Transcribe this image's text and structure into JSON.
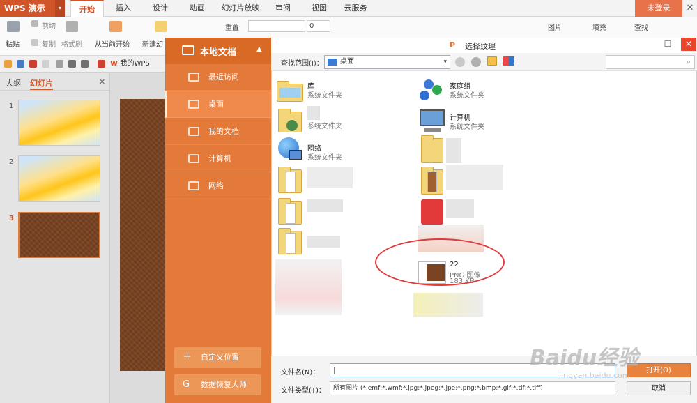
{
  "app": {
    "name": "WPS 演示",
    "login": "未登录",
    "close": "✕",
    "dropdown_arrow": "▾"
  },
  "tabs": [
    "开始",
    "插入",
    "设计",
    "动画",
    "幻灯片放映",
    "审阅",
    "视图",
    "云服务"
  ],
  "active_tab": "开始",
  "ribbon": {
    "paste": "粘贴",
    "cut": "剪切",
    "copy": "复制",
    "format_painter": "格式刷",
    "from_current": "从当前开始",
    "new_slide": "新建幻",
    "reset": "重置",
    "font_size": "0",
    "picture": "图片",
    "fill": "填充",
    "find": "查找"
  },
  "quickbar": {
    "doc_tab": "我的WPS"
  },
  "leftpanel": {
    "tab_outline": "大纲",
    "tab_slides": "幻灯片",
    "close": "✕",
    "slides": [
      {
        "num": "1",
        "kind": "gradient"
      },
      {
        "num": "2",
        "kind": "gradient"
      },
      {
        "num": "3",
        "kind": "leather",
        "selected": true
      }
    ]
  },
  "sidebar": {
    "title": "本地文档",
    "items": [
      {
        "label": "最近访问",
        "icon": "recent-folder-icon"
      },
      {
        "label": "桌面",
        "icon": "desktop-icon",
        "active": true
      },
      {
        "label": "我的文档",
        "icon": "documents-folder-icon"
      },
      {
        "label": "计算机",
        "icon": "computer-icon"
      },
      {
        "label": "网络",
        "icon": "network-icon"
      }
    ],
    "custom_location": "自定义位置",
    "data_recovery": "数据恢复大师"
  },
  "dialog": {
    "title": "选择纹理",
    "look_in_label": "查找范围(I)：",
    "look_in_value": "桌面",
    "files": [
      {
        "name": "库",
        "type": "系统文件夹",
        "icon": "library-icon"
      },
      {
        "name": "家庭组",
        "type": "系统文件夹",
        "icon": "homegroup-icon"
      },
      {
        "name": "",
        "type": "系统文件夹",
        "icon": "user-folder-icon"
      },
      {
        "name": "计算机",
        "type": "系统文件夹",
        "icon": "computer-icon"
      },
      {
        "name": "网络",
        "type": "系统文件夹",
        "icon": "network-icon"
      },
      {
        "name": "22",
        "type": "PNG 图像",
        "size": "183 KB",
        "icon": "png-image-icon"
      }
    ],
    "filename_label": "文件名(N)：",
    "filename_value": "|",
    "filetype_label": "文件类型(T)：",
    "filetype_value": "所有图片 (*.emf;*.wmf;*.jpg;*.jpeg;*.jpe;*.png;*.bmp;*.gif;*.tif;*.tiff)",
    "open_button": "打开(O)",
    "cancel_button": "取消"
  },
  "watermark": {
    "brand": "Baidu经验",
    "url": "jingyan.baidu.com"
  },
  "colors": {
    "accent": "#d2552a",
    "sidebar": "#e47a3a",
    "highlight": "#e23a3a"
  }
}
